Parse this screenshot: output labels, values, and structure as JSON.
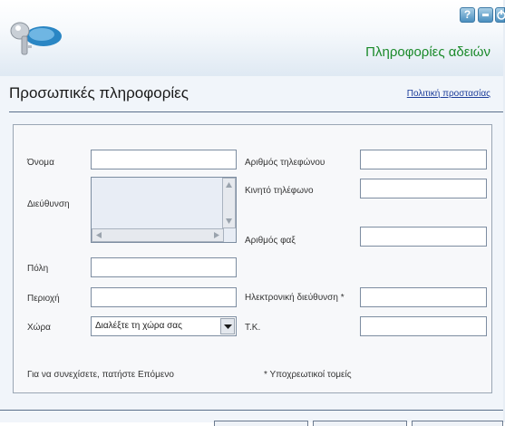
{
  "app": {
    "title": "Πληροφορίες αδειών",
    "help_glyph": "?"
  },
  "page": {
    "title": "Προσωπικές πληροφορίες",
    "policy_link": "Πολιτική προστασίας"
  },
  "form": {
    "name_label": "Όνομα",
    "address_label": "Διεύθυνση",
    "city_label": "Πόλη",
    "region_label": "Περιοχή",
    "country_label": "Χώρα",
    "country_value": "Διαλέξτε τη χώρα σας",
    "phone_label": "Αριθμός τηλεφώνου",
    "mobile_label": "Κινητό τηλέφωνο",
    "fax_label": "Αριθμός φαξ",
    "email_label": "Ηλεκτρονική διεύθυνση *",
    "zip_label": "Τ.Κ.",
    "continue_text": "Για να συνεχίσετε, πατήστε Επόμενο",
    "required_text": "* Υποχρεωτικοί τομείς"
  },
  "colors": {
    "title_green": "#1a8a2a",
    "link_blue": "#1c3d9a",
    "button_blue": "#4a8fbf"
  },
  "icons": [
    "keys-logo-icon",
    "help-icon",
    "minimize-icon",
    "power-icon",
    "scroll-up-icon",
    "scroll-down-icon",
    "scroll-left-icon",
    "scroll-right-icon",
    "dropdown-arrow-icon"
  ]
}
